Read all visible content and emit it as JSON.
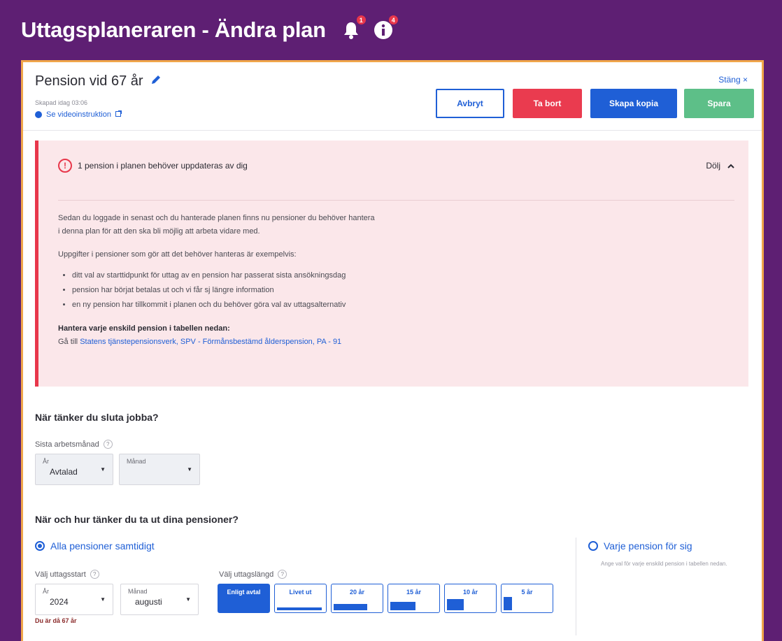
{
  "app": {
    "title": "Uttagsplaneraren - Ändra plan",
    "notifications_badge": "1",
    "info_badge": "4"
  },
  "plan": {
    "title": "Pension vid 67 år",
    "created": "Skapad idag 03:06",
    "video_link": "Se videoinstruktion",
    "close_label": "Stäng ×"
  },
  "toolbar": {
    "cancel_label": "Avbryt",
    "delete_label": "Ta bort",
    "copy_label": "Skapa kopia",
    "save_label": "Spara"
  },
  "alert": {
    "icon_text": "!",
    "heading": "1 pension i planen behöver uppdateras av dig",
    "hide_label": "Dölj",
    "paragraph1_line1": "Sedan du loggade in senast och du hanterade planen finns nu pensioner du behöver hantera",
    "paragraph1_line2": "i denna plan för att den ska bli möjlig att arbeta vidare med.",
    "paragraph2": "Uppgifter i pensioner som gör att det behöver hanteras är exempelvis:",
    "bullets": [
      "ditt val av starttidpunkt för uttag av en pension har passerat sista ansökningsdag",
      "pension har börjat betalas ut och vi får sj längre information",
      "en ny pension har tillkommit i planen och du behöver göra val av uttagsalternativ"
    ],
    "manage_heading": "Hantera varje enskild pension i tabellen nedan:",
    "goto_prefix": "Gå till",
    "goto_link": "Statens tjänstepensionsverk, SPV - Förmånsbestämd ålderspension, PA - 91"
  },
  "stop_work": {
    "title": "När tänker du sluta jobba?",
    "last_month_label": "Sista arbetsmånad",
    "year_small": "År",
    "year_value": "Avtalad",
    "month_small": "Månad",
    "month_value": ""
  },
  "withdraw": {
    "title": "När och hur tänker du ta ut dina pensioner?",
    "option_all": "Alla pensioner samtidigt",
    "option_each": "Varje pension för sig",
    "option_each_desc": "Ange val för varje enskild pension i tabellen nedan.",
    "start_label": "Välj uttagsstart",
    "start_year_small": "År",
    "start_year_value": "2024",
    "start_month_small": "Månad",
    "start_month_value": "augusti",
    "length_label": "Välj uttagslängd",
    "age_note": "Du är då 67 år",
    "lengths": [
      {
        "label": "Enligt avtal",
        "fill": 1.0
      },
      {
        "label": "Livet ut",
        "fill": 0.95
      },
      {
        "label": "20 år",
        "fill": 0.72
      },
      {
        "label": "15 år",
        "fill": 0.54
      },
      {
        "label": "10 år",
        "fill": 0.36
      },
      {
        "label": "5 år",
        "fill": 0.18
      }
    ]
  },
  "colors": {
    "brand": "#5e1f73",
    "primary": "#1f5fd6",
    "danger": "#ea3b4f",
    "success": "#5dbf88",
    "alert_bg": "#fbe7ea"
  }
}
